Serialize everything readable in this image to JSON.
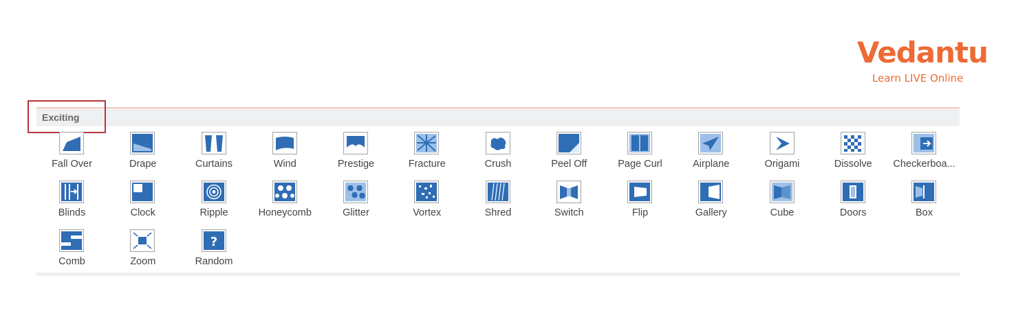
{
  "logo": {
    "word": "Vedantu",
    "tagline": "Learn LIVE Online",
    "color": "#ee6a35"
  },
  "section": {
    "title": "Exciting",
    "highlight_color": "#b8343b"
  },
  "accent_color": "#2f6db5",
  "transitions": [
    {
      "label": "Fall Over",
      "icon": "fall-over-icon"
    },
    {
      "label": "Drape",
      "icon": "drape-icon"
    },
    {
      "label": "Curtains",
      "icon": "curtains-icon"
    },
    {
      "label": "Wind",
      "icon": "wind-icon"
    },
    {
      "label": "Prestige",
      "icon": "prestige-icon"
    },
    {
      "label": "Fracture",
      "icon": "fracture-icon"
    },
    {
      "label": "Crush",
      "icon": "crush-icon"
    },
    {
      "label": "Peel Off",
      "icon": "peel-off-icon"
    },
    {
      "label": "Page Curl",
      "icon": "page-curl-icon"
    },
    {
      "label": "Airplane",
      "icon": "airplane-icon"
    },
    {
      "label": "Origami",
      "icon": "origami-icon"
    },
    {
      "label": "Dissolve",
      "icon": "dissolve-icon"
    },
    {
      "label": "Checkerboa...",
      "icon": "checkerboard-icon"
    },
    {
      "label": "Blinds",
      "icon": "blinds-icon"
    },
    {
      "label": "Clock",
      "icon": "clock-icon"
    },
    {
      "label": "Ripple",
      "icon": "ripple-icon"
    },
    {
      "label": "Honeycomb",
      "icon": "honeycomb-icon"
    },
    {
      "label": "Glitter",
      "icon": "glitter-icon"
    },
    {
      "label": "Vortex",
      "icon": "vortex-icon"
    },
    {
      "label": "Shred",
      "icon": "shred-icon"
    },
    {
      "label": "Switch",
      "icon": "switch-icon"
    },
    {
      "label": "Flip",
      "icon": "flip-icon"
    },
    {
      "label": "Gallery",
      "icon": "gallery-icon"
    },
    {
      "label": "Cube",
      "icon": "cube-icon"
    },
    {
      "label": "Doors",
      "icon": "doors-icon"
    },
    {
      "label": "Box",
      "icon": "box-icon"
    },
    {
      "label": "Comb",
      "icon": "comb-icon"
    },
    {
      "label": "Zoom",
      "icon": "zoom-icon"
    },
    {
      "label": "Random",
      "icon": "random-icon"
    }
  ]
}
